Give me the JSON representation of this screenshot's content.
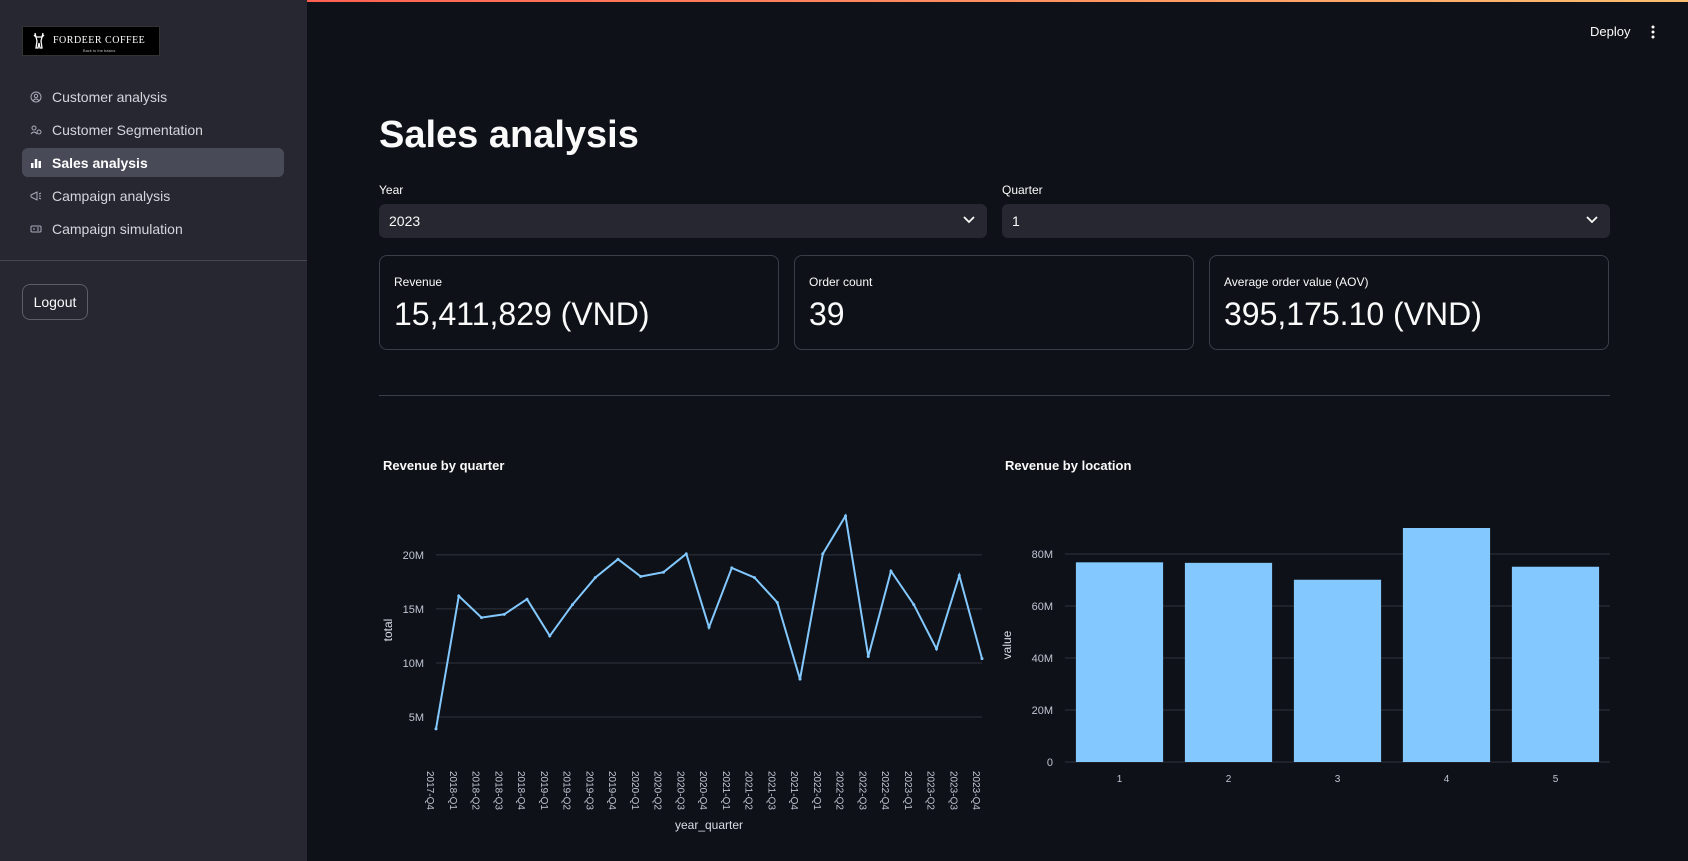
{
  "app": {
    "deploy_label": "Deploy"
  },
  "sidebar": {
    "logo_text": "FORDEER COFFEE",
    "logo_tagline": "Back to the basics",
    "items": [
      {
        "label": "Customer analysis",
        "icon": "user-circle-icon",
        "active": false
      },
      {
        "label": "Customer Segmentation",
        "icon": "people-icon",
        "active": false
      },
      {
        "label": "Sales analysis",
        "icon": "bar-chart-icon",
        "active": true
      },
      {
        "label": "Campaign analysis",
        "icon": "megaphone-icon",
        "active": false
      },
      {
        "label": "Campaign simulation",
        "icon": "simulation-icon",
        "active": false
      }
    ],
    "logout_label": "Logout"
  },
  "main": {
    "title": "Sales analysis",
    "filters": {
      "year": {
        "label": "Year",
        "value": "2023"
      },
      "quarter": {
        "label": "Quarter",
        "value": "1"
      }
    },
    "metrics": [
      {
        "label": "Revenue",
        "value": "15,411,829 (VND)"
      },
      {
        "label": "Order count",
        "value": "39"
      },
      {
        "label": "Average order value (AOV)",
        "value": "395,175.10 (VND)"
      }
    ],
    "colors": {
      "accent": "#83c9ff",
      "background": "#0e1117",
      "sidebar": "#262730"
    }
  },
  "chart_data": [
    {
      "type": "line",
      "title": "Revenue by quarter",
      "xlabel": "year_quarter",
      "ylabel": "total",
      "x": [
        "2017-Q4",
        "2018-Q1",
        "2018-Q2",
        "2018-Q3",
        "2018-Q4",
        "2019-Q1",
        "2019-Q2",
        "2019-Q3",
        "2019-Q4",
        "2020-Q1",
        "2020-Q2",
        "2020-Q3",
        "2020-Q4",
        "2021-Q1",
        "2021-Q2",
        "2021-Q3",
        "2021-Q4",
        "2022-Q1",
        "2022-Q2",
        "2022-Q3",
        "2022-Q4",
        "2023-Q1",
        "2023-Q2",
        "2023-Q3",
        "2023-Q4"
      ],
      "values": [
        3.9,
        16.2,
        14.2,
        14.5,
        15.9,
        12.5,
        15.4,
        17.9,
        19.6,
        18.0,
        18.4,
        20.1,
        13.3,
        18.8,
        17.9,
        15.6,
        8.5,
        20.1,
        23.6,
        10.6,
        18.5,
        15.4,
        11.3,
        18.1,
        10.4
      ],
      "value_unit": "M",
      "yticks": [
        "5M",
        "10M",
        "15M",
        "20M"
      ],
      "ylim": [
        2.5,
        23.6
      ],
      "grid": true,
      "color": "#83c9ff"
    },
    {
      "type": "bar",
      "title": "Revenue by location",
      "ylabel": "value",
      "categories": [
        "1",
        "2",
        "3",
        "4",
        "5"
      ],
      "values": [
        76.8,
        76.6,
        70.1,
        90.0,
        75.1
      ],
      "value_unit": "M",
      "yticks": [
        "0",
        "20M",
        "40M",
        "60M",
        "80M"
      ],
      "ylim": [
        0,
        90
      ],
      "grid": true,
      "color": "#83c9ff"
    }
  ]
}
